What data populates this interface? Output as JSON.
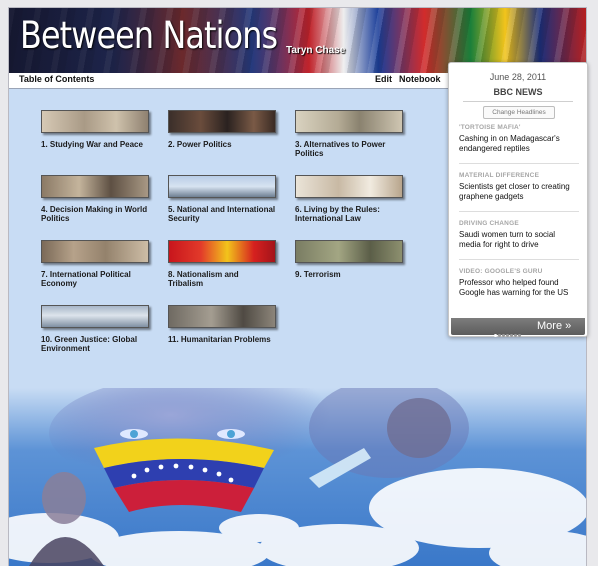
{
  "header": {
    "title": "Between Nations",
    "author": "Taryn Chase"
  },
  "nav": {
    "toc": "Table of Contents",
    "edit": "Edit",
    "notebook": "Notebook"
  },
  "chapters": [
    {
      "label": "1. Studying War and Peace"
    },
    {
      "label": "2. Power Politics"
    },
    {
      "label": "3. Alternatives to Power Politics"
    },
    {
      "label": "4. Decision Making in World Politics"
    },
    {
      "label": "5. National and International Security"
    },
    {
      "label": "6. Living by the Rules: International Law"
    },
    {
      "label": "7. International Political Economy"
    },
    {
      "label": "8. Nationalism and Tribalism"
    },
    {
      "label": "9. Terrorism"
    },
    {
      "label": "10. Green Justice: Global Environment"
    },
    {
      "label": "11. Humanitarian Problems"
    }
  ],
  "news": {
    "date": "June 28, 2011",
    "source": "BBC NEWS",
    "change_label": "Change Headlines",
    "items": [
      {
        "category": "'TORTOISE MAFIA'",
        "headline": "Cashing in on Madagascar's endangered reptiles"
      },
      {
        "category": "MATERIAL DIFFERENCE",
        "headline": "Scientists get closer to creating graphene gadgets"
      },
      {
        "category": "DRIVING CHANGE",
        "headline": "Saudi women turn to social media for right to drive"
      },
      {
        "category": "VIDEO: GOOGLE'S GURU",
        "headline": "Professor who helped found Google has warning for the US"
      }
    ],
    "more_label": "More »"
  },
  "colors": {
    "background": "#c8dcf4",
    "accent": "#4a6db5"
  }
}
